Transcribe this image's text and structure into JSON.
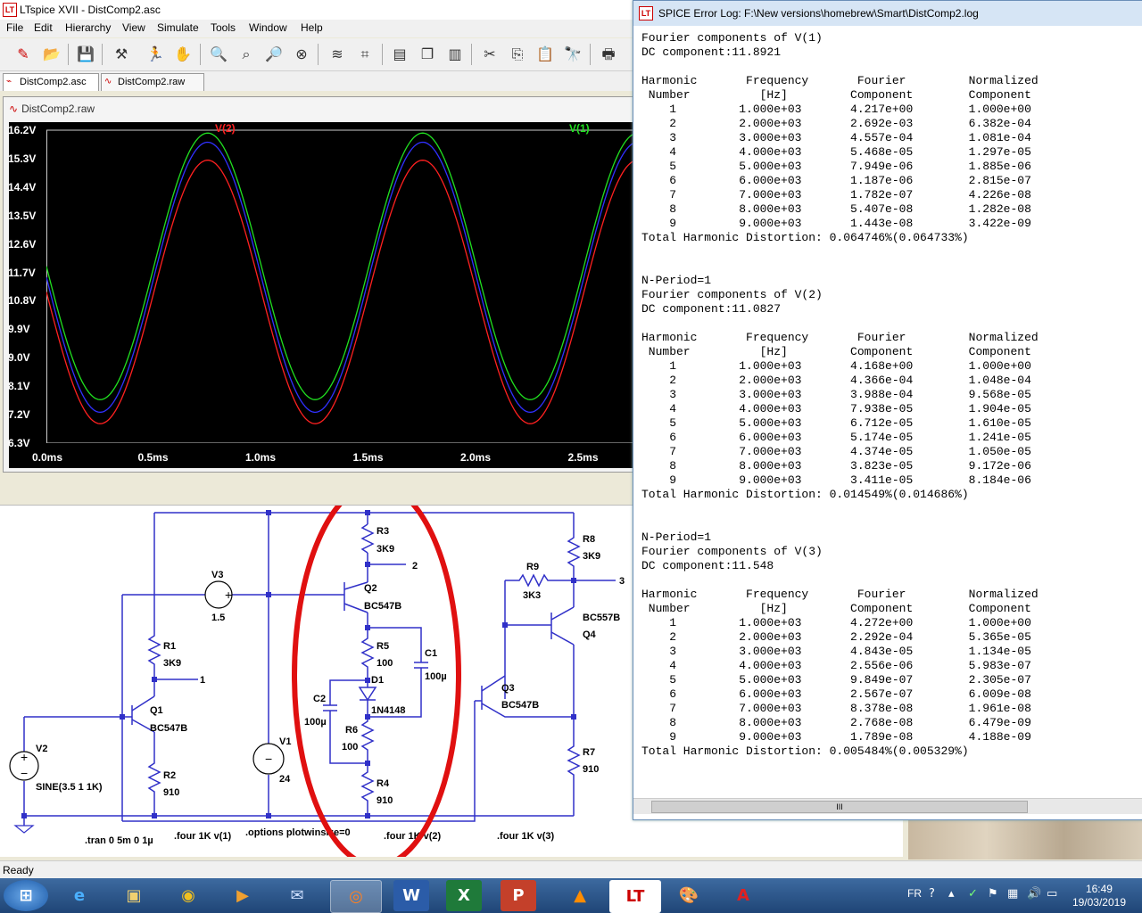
{
  "main_window": {
    "title": "LTspice XVII - DistComp2.asc",
    "menu": [
      "File",
      "Edit",
      "Hierarchy",
      "View",
      "Simulate",
      "Tools",
      "Window",
      "Help"
    ],
    "tabs": [
      {
        "label": "DistComp2.asc",
        "icon": "schematic-icon"
      },
      {
        "label": "DistComp2.raw",
        "icon": "waveform-icon"
      }
    ],
    "status": "Ready"
  },
  "plot": {
    "window_title": "DistComp2.raw",
    "trace_labels": [
      {
        "name": "V(2)",
        "color": "#ff2020"
      },
      {
        "name": "V(1)",
        "color": "#20e020"
      }
    ],
    "trace_colors": {
      "v1": "#20e020",
      "v2": "#ff2020",
      "v3": "#3030ff"
    },
    "y_ticks": [
      "16.2V",
      "15.3V",
      "14.4V",
      "13.5V",
      "12.6V",
      "11.7V",
      "10.8V",
      "9.9V",
      "9.0V",
      "8.1V",
      "7.2V",
      "6.3V"
    ],
    "x_ticks": [
      "0.0ms",
      "0.5ms",
      "1.0ms",
      "1.5ms",
      "2.0ms",
      "2.5ms"
    ]
  },
  "chart_data": {
    "type": "line",
    "xlabel": "",
    "ylabel": "",
    "xlim": [
      0,
      2.75
    ],
    "ylim": [
      6.3,
      16.2
    ],
    "x_unit": "ms",
    "y_unit": "V",
    "series": [
      {
        "name": "V(1)",
        "dc": 11.8921,
        "amplitude": 4.217,
        "freq_khz": 1
      },
      {
        "name": "V(2)",
        "dc": 11.0827,
        "amplitude": 4.168,
        "freq_khz": 1
      },
      {
        "name": "V(3)",
        "dc": 11.548,
        "amplitude": 4.272,
        "freq_khz": 1
      }
    ]
  },
  "schematic": {
    "components": {
      "r3": {
        "name": "R3",
        "value": "3K9"
      },
      "r8": {
        "name": "R8",
        "value": "3K9"
      },
      "r9": {
        "name": "R9",
        "value": "3K3"
      },
      "r1": {
        "name": "R1",
        "value": "3K9"
      },
      "r5": {
        "name": "R5",
        "value": "100"
      },
      "r6": {
        "name": "R6",
        "value": "100"
      },
      "r2": {
        "name": "R2",
        "value": "910"
      },
      "r4": {
        "name": "R4",
        "value": "910"
      },
      "r7": {
        "name": "R7",
        "value": "910"
      },
      "c1": {
        "name": "C1",
        "value": "100µ"
      },
      "c2": {
        "name": "C2",
        "value": "100µ"
      },
      "d1": {
        "name": "D1",
        "value": "1N4148"
      },
      "q1": {
        "name": "Q1",
        "value": "BC547B"
      },
      "q2": {
        "name": "Q2",
        "value": "BC547B"
      },
      "q3": {
        "name": "Q3",
        "value": "BC547B"
      },
      "q4": {
        "name": "Q4",
        "value": "BC557B"
      },
      "v1": {
        "name": "V1",
        "value": "24"
      },
      "v2": {
        "name": "V2",
        "value": "SINE(3.5 1 1K)"
      },
      "v3": {
        "name": "V3",
        "value": "1.5"
      }
    },
    "net_labels": [
      "1",
      "2",
      "3"
    ],
    "directives": [
      ".tran 0 5m 0 1µ",
      ".four 1K v(1)",
      ".options plotwinsize=0",
      ".four 1K v(2)",
      ".four 1K v(3)"
    ]
  },
  "log_window": {
    "title": "SPICE Error Log: F:\\New versions\\homebrew\\Smart\\DistComp2.log",
    "scroll_thumb": "III",
    "lines": [
      "Fourier components of V(1)",
      "DC component:11.8921",
      "",
      "Harmonic       Frequency       Fourier         Normalized",
      " Number          [Hz]         Component        Component",
      "    1         1.000e+03       4.217e+00        1.000e+00",
      "    2         2.000e+03       2.692e-03        6.382e-04",
      "    3         3.000e+03       4.557e-04        1.081e-04",
      "    4         4.000e+03       5.468e-05        1.297e-05",
      "    5         5.000e+03       7.949e-06        1.885e-06",
      "    6         6.000e+03       1.187e-06        2.815e-07",
      "    7         7.000e+03       1.782e-07        4.226e-08",
      "    8         8.000e+03       5.407e-08        1.282e-08",
      "    9         9.000e+03       1.443e-08        3.422e-09",
      "Total Harmonic Distortion: 0.064746%(0.064733%)",
      "",
      "",
      "N-Period=1",
      "Fourier components of V(2)",
      "DC component:11.0827",
      "",
      "Harmonic       Frequency       Fourier         Normalized",
      " Number          [Hz]         Component        Component",
      "    1         1.000e+03       4.168e+00        1.000e+00",
      "    2         2.000e+03       4.366e-04        1.048e-04",
      "    3         3.000e+03       3.988e-04        9.568e-05",
      "    4         4.000e+03       7.938e-05        1.904e-05",
      "    5         5.000e+03       6.712e-05        1.610e-05",
      "    6         6.000e+03       5.174e-05        1.241e-05",
      "    7         7.000e+03       4.374e-05        1.050e-05",
      "    8         8.000e+03       3.823e-05        9.172e-06",
      "    9         9.000e+03       3.411e-05        8.184e-06",
      "Total Harmonic Distortion: 0.014549%(0.014686%)",
      "",
      "",
      "N-Period=1",
      "Fourier components of V(3)",
      "DC component:11.548",
      "",
      "Harmonic       Frequency       Fourier         Normalized",
      " Number          [Hz]         Component        Component",
      "    1         1.000e+03       4.272e+00        1.000e+00",
      "    2         2.000e+03       2.292e-04        5.365e-05",
      "    3         3.000e+03       4.843e-05        1.134e-05",
      "    4         4.000e+03       2.556e-06        5.983e-07",
      "    5         5.000e+03       9.849e-07        2.305e-07",
      "    6         6.000e+03       2.567e-07        6.009e-08",
      "    7         7.000e+03       8.378e-08        1.961e-08",
      "    8         8.000e+03       2.768e-08        6.479e-09",
      "    9         9.000e+03       1.789e-08        4.188e-09",
      "Total Harmonic Distortion: 0.005484%(0.005329%)"
    ]
  },
  "taskbar": {
    "apps": [
      "start-orb-icon",
      "ie-icon",
      "explorer-icon",
      "chrome-icon",
      "media-icon",
      "mail-icon",
      "firefox-icon",
      "word-icon",
      "excel-icon",
      "powerpoint-icon",
      "vlc-icon",
      "ltspice-icon",
      "paint-icon",
      "acrobat-icon"
    ],
    "language": "FR",
    "time": "16:49",
    "date": "19/03/2019"
  }
}
